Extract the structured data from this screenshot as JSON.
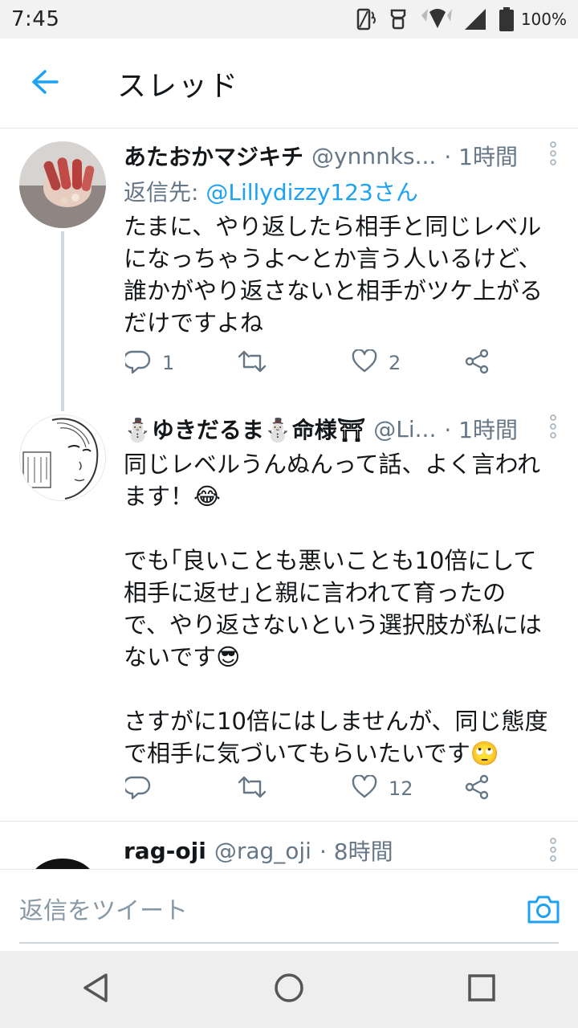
{
  "status_bar": {
    "time": "7:45",
    "battery": "100%"
  },
  "header": {
    "title": "スレッド"
  },
  "tweets": [
    {
      "display_name": "あたおかマジキチ",
      "handle": "@ynnnks...",
      "time": "· 1時間",
      "reply_prefix": "返信先: ",
      "reply_mention": "@Lillydizzy123さん",
      "text": "たまに、やり返したら相手と同じレベル\nになっちゃうよ〜とか言う人いるけど、\n誰かがやり返さないと相手がツケ上がる\nだけですよね",
      "likes": "2",
      "replies": "1"
    },
    {
      "display_name": "⛄ゆきだるま⛄命様⛩",
      "handle": "@Li...",
      "time": "· 1時間",
      "text": "同じレベルうんぬんって話、よく言われ\nます！😂\n\nでも｢良いことも悪いことも10倍にして\n相手に返せ｣と親に言われて育ったの\nで、やり返さないという選択肢が私には\nないです😎\n\nさすがに10倍にはしませんが、同じ態度\nで相手に気づいてもらいたいです🙄",
      "likes": "12"
    },
    {
      "display_name": "rag-oji",
      "handle": "@rag_oji",
      "time": "· 8時間"
    }
  ],
  "compose": {
    "placeholder": "返信をツイート"
  },
  "icons": {
    "back": "arrow-left-icon",
    "more": "more-vertical-icon",
    "reply": "reply-icon",
    "retweet": "retweet-icon",
    "like": "heart-icon",
    "share": "share-icon",
    "camera": "camera-icon"
  },
  "colors": {
    "accent": "#1da1f2",
    "secondary_text": "#657786",
    "primary_text": "#14171a"
  }
}
